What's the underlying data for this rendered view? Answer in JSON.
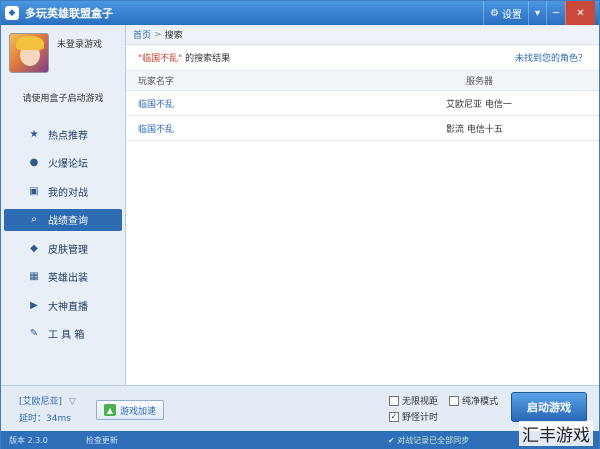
{
  "window": {
    "title": "多玩英雄联盟盒子",
    "settings_label": "设置",
    "minimize_label": "─",
    "close_label": "✕"
  },
  "sidebar": {
    "login_status": "未登录游戏",
    "hint": "请使用盒子启动游戏",
    "items": [
      {
        "label": "热点推荐",
        "icon": "star-icon"
      },
      {
        "label": "火爆论坛",
        "icon": "chat-icon"
      },
      {
        "label": "我的对战",
        "icon": "battle-icon"
      },
      {
        "label": "战绩查询",
        "icon": "search-icon",
        "active": true
      },
      {
        "label": "皮肤管理",
        "icon": "skin-icon"
      },
      {
        "label": "英雄出装",
        "icon": "equipment-icon"
      },
      {
        "label": "大神直播",
        "icon": "play-icon"
      },
      {
        "label": "工 具 箱",
        "icon": "wrench-icon"
      }
    ]
  },
  "breadcrumb": {
    "home": "首页",
    "separator": ">",
    "current": "搜索"
  },
  "search": {
    "query": "\"临国不乱\"",
    "suffix": "的搜索结果",
    "not_found_link": "未找到您的角色？"
  },
  "table": {
    "headers": [
      "玩家名字",
      "服务器"
    ],
    "rows": [
      {
        "player": "临国不乱",
        "server": "艾欧尼亚 电信一"
      },
      {
        "player": "临国不乱",
        "server": "影流 电信十五"
      }
    ]
  },
  "bottom": {
    "region": "[艾欧尼亚]",
    "ping": "延时：34ms",
    "accelerate_label": "游戏加速",
    "checkboxes": [
      {
        "label": "无限视距",
        "checked": false
      },
      {
        "label": "纯净模式",
        "checked": false
      },
      {
        "label": "野怪计时",
        "checked": true
      }
    ],
    "launch_label": "启动游戏"
  },
  "status": {
    "version": "版本 2.3.0",
    "update": "检查更新",
    "record": "对战记录已全部同步"
  },
  "watermark": "汇丰游戏",
  "colors": {
    "accent": "#2d6bb3",
    "titlebar": "#3b86d6",
    "query": "#c0392b"
  }
}
